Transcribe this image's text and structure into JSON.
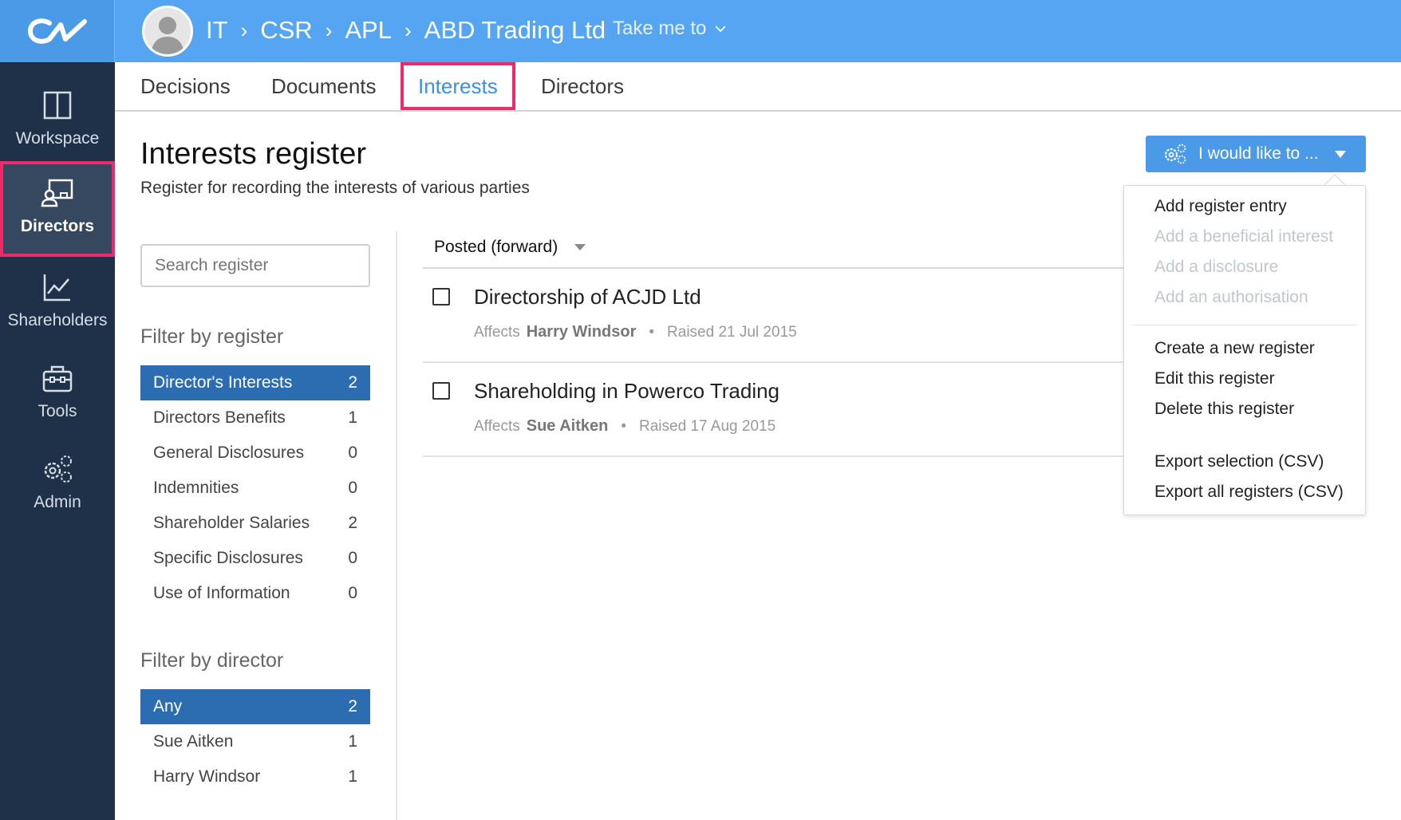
{
  "breadcrumb": [
    "IT",
    "CSR",
    "APL",
    "ABD Trading Ltd"
  ],
  "take_me_to": "Take me to",
  "sidebar": [
    {
      "label": "Workspace",
      "icon": "columns-icon"
    },
    {
      "label": "Directors",
      "icon": "directors-icon",
      "active": true
    },
    {
      "label": "Shareholders",
      "icon": "chart-icon"
    },
    {
      "label": "Tools",
      "icon": "toolbox-icon"
    },
    {
      "label": "Admin",
      "icon": "gears-icon"
    }
  ],
  "tabs": [
    "Decisions",
    "Documents",
    "Interests",
    "Directors"
  ],
  "active_tab": "Interests",
  "page": {
    "title": "Interests register",
    "subtitle": "Register for recording the interests of various parties"
  },
  "search": {
    "placeholder": "Search register"
  },
  "filter_register": {
    "heading": "Filter by register",
    "items": [
      {
        "label": "Director's Interests",
        "count": "2",
        "selected": true
      },
      {
        "label": "Directors Benefits",
        "count": "1"
      },
      {
        "label": "General Disclosures",
        "count": "0"
      },
      {
        "label": "Indemnities",
        "count": "0"
      },
      {
        "label": "Shareholder Salaries",
        "count": "2"
      },
      {
        "label": "Specific Disclosures",
        "count": "0"
      },
      {
        "label": "Use of Information",
        "count": "0"
      }
    ]
  },
  "filter_director": {
    "heading": "Filter by director",
    "items": [
      {
        "label": "Any",
        "count": "2",
        "selected": true
      },
      {
        "label": "Sue Aitken",
        "count": "1"
      },
      {
        "label": "Harry Windsor",
        "count": "1"
      }
    ]
  },
  "sort": {
    "label": "Posted (forward)"
  },
  "entries": [
    {
      "title": "Directorship of ACJD Ltd",
      "affects_label": "Affects",
      "affects": "Harry Windsor",
      "raised": "Raised 21 Jul 2015"
    },
    {
      "title": "Shareholding in Powerco Trading",
      "affects_label": "Affects",
      "affects": "Sue Aitken",
      "raised": "Raised 17 Aug 2015"
    }
  ],
  "action": {
    "label": "I would like to ...",
    "menu": {
      "entries": [
        "Add register entry",
        "Add a beneficial interest",
        "Add a disclosure",
        "Add an authorisation"
      ],
      "manage": [
        "Create a new register",
        "Edit this register",
        "Delete this register"
      ],
      "export": [
        "Export selection (CSV)",
        "Export all registers (CSV)"
      ]
    }
  },
  "colors": {
    "topbar": "#55a5f3",
    "sidebar": "#1e3148",
    "accent": "#4a9ae8",
    "highlight": "#f0296d",
    "selected": "#2c6db2"
  }
}
